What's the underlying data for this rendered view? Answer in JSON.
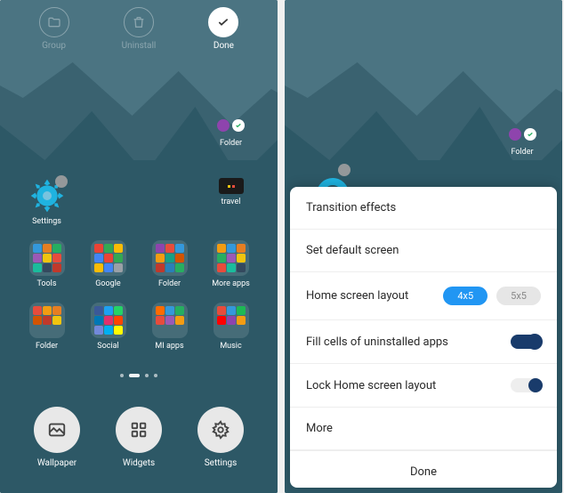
{
  "left": {
    "top_buttons": [
      {
        "name": "group",
        "label": "Group"
      },
      {
        "name": "uninstall",
        "label": "Uninstall"
      },
      {
        "name": "done",
        "label": "Done"
      }
    ],
    "apps": [
      {
        "row": 0,
        "col": 3,
        "type": "pair",
        "label": "Folder",
        "colors": [
          "#8e44ad",
          "#ffffff"
        ]
      },
      {
        "row": 1,
        "col": 0,
        "type": "gear",
        "label": "Settings",
        "selected": true
      },
      {
        "row": 1,
        "col": 3,
        "type": "single",
        "label": "travel",
        "colors": [
          "#1a1a1a"
        ]
      },
      {
        "row": 2,
        "col": 0,
        "type": "folder",
        "label": "Tools",
        "colors": [
          "#3498db",
          "#e67e22",
          "#27ae60",
          "#9b59b6",
          "#f1c40f",
          "#e74c3c",
          "#1abc9c",
          "#34495e",
          "#c0392b"
        ]
      },
      {
        "row": 2,
        "col": 1,
        "type": "folder",
        "label": "Google",
        "colors": [
          "#ea4335",
          "#34a853",
          "#fbbc05",
          "#4285f4",
          "#ea4335",
          "#34a853",
          "#fbbc05",
          "#4285f4",
          "#9aa0a6"
        ]
      },
      {
        "row": 2,
        "col": 2,
        "type": "folder",
        "label": "Folder",
        "colors": [
          "#8e44ad",
          "#e74c3c",
          "#3498db",
          "#f39c12",
          "#16a085",
          "#d35400",
          "#c0392b",
          "#2980b9",
          "#27ae60"
        ]
      },
      {
        "row": 2,
        "col": 3,
        "type": "folder",
        "label": "More apps",
        "colors": [
          "#f39c12",
          "#3498db",
          "#e67e22",
          "#27ae60",
          "#9b59b6",
          "#f1c40f",
          "#e74c3c",
          "#1abc9c",
          "#34495e"
        ]
      },
      {
        "row": 3,
        "col": 0,
        "type": "folder",
        "label": "Folder",
        "colors": [
          "#e74c3c",
          "#f39c12",
          "#e67e22",
          "#d35400",
          "#c0392b",
          "#f1c40f"
        ]
      },
      {
        "row": 3,
        "col": 1,
        "type": "folder",
        "label": "Social",
        "colors": [
          "#3b5998",
          "#1da1f2",
          "#25d366",
          "#0077b5",
          "#e1306c",
          "#ff4500",
          "#7289da",
          "#00aff0",
          "#fffc00"
        ]
      },
      {
        "row": 3,
        "col": 2,
        "type": "folder",
        "label": "MI apps",
        "colors": [
          "#ff6b00",
          "#3498db",
          "#27ae60",
          "#e74c3c",
          "#9b59b6",
          "#f39c12"
        ]
      },
      {
        "row": 3,
        "col": 3,
        "type": "folder",
        "label": "Music",
        "colors": [
          "#e74c3c",
          "#3498db",
          "#1db954",
          "#ff0000",
          "#8e44ad",
          "#f39c12"
        ]
      }
    ],
    "bottom": [
      {
        "name": "wallpaper",
        "label": "Wallpaper"
      },
      {
        "name": "widgets",
        "label": "Widgets"
      },
      {
        "name": "settings",
        "label": "Settings"
      }
    ]
  },
  "right": {
    "folder_label": "Folder",
    "sheet": {
      "rows": {
        "transition": "Transition effects",
        "default_screen": "Set default screen",
        "layout": "Home screen layout",
        "layout_options": {
          "active": "4x5",
          "inactive": "5x5"
        },
        "fill_cells": "Fill cells of uninstalled apps",
        "lock_layout": "Lock Home screen layout",
        "more": "More"
      },
      "done": "Done"
    }
  }
}
